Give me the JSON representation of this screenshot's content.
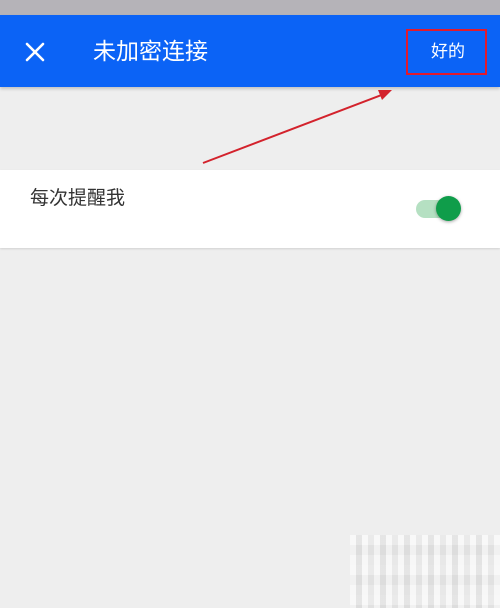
{
  "app_bar": {
    "close_icon": "close-icon",
    "title": "未加密连接",
    "ok_label": "好的",
    "background_color": "#0b63f6"
  },
  "settings": {
    "remind_label": "每次提醒我",
    "remind_toggle_on": true,
    "toggle_color": "#0f9d4a"
  },
  "annotation": {
    "highlight_color": "#e11a2d"
  }
}
